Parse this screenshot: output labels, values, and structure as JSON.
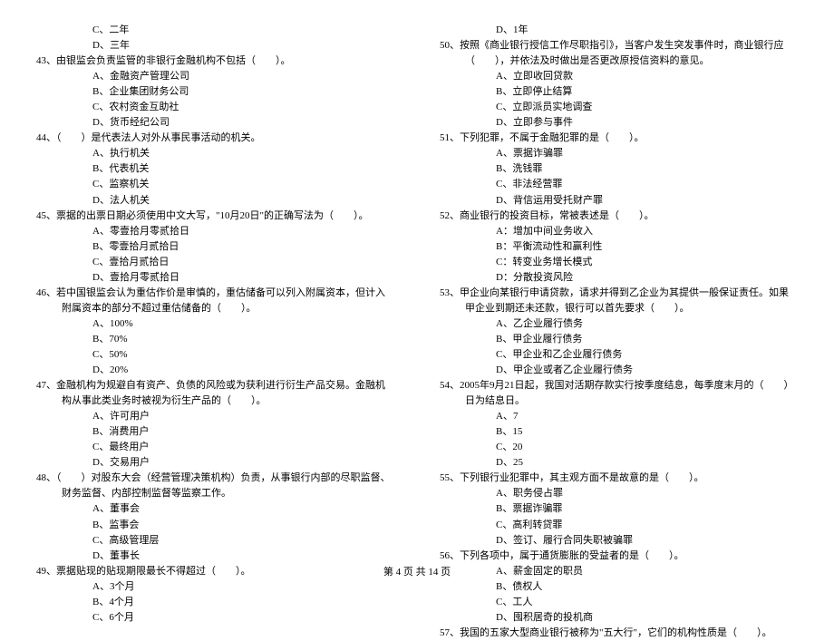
{
  "left": {
    "pre_options": [
      "C、二年",
      "D、三年"
    ],
    "questions": [
      {
        "num": "43",
        "text": "由银监会负责监管的非银行金融机构不包括（　　）。",
        "options": [
          "A、金融资产管理公司",
          "B、企业集团财务公司",
          "C、农村资金互助社",
          "D、货币经纪公司"
        ]
      },
      {
        "num": "44",
        "text": "（　　）是代表法人对外从事民事活动的机关。",
        "options": [
          "A、执行机关",
          "B、代表机关",
          "C、监察机关",
          "D、法人机关"
        ]
      },
      {
        "num": "45",
        "text": "票据的出票日期必须使用中文大写，\"10月20日\"的正确写法为（　　）。",
        "options": [
          "A、零壹拾月零贰拾日",
          "B、零壹拾月贰拾日",
          "C、壹拾月贰拾日",
          "D、壹拾月零贰拾日"
        ]
      },
      {
        "num": "46",
        "text": "若中国银监会认为重估作价是审慎的，重估储备可以列入附属资本，但计入附属资本的部分不超过重估储备的（　　）。",
        "options": [
          "A、100%",
          "B、70%",
          "C、50%",
          "D、20%"
        ]
      },
      {
        "num": "47",
        "text": "金融机构为规避自有资产、负债的风险或为获利进行衍生产品交易。金融机构从事此类业务时被视为衍生产品的（　　）。",
        "options": [
          "A、许可用户",
          "B、消费用户",
          "C、最终用户",
          "D、交易用户"
        ]
      },
      {
        "num": "48",
        "text": "（　　）对股东大会（经营管理决策机构）负责，从事银行内部的尽职监督、财务监督、内部控制监督等监察工作。",
        "options": [
          "A、董事会",
          "B、监事会",
          "C、高级管理层",
          "D、董事长"
        ]
      },
      {
        "num": "49",
        "text": "票据贴现的贴现期限最长不得超过（　　）。",
        "options": [
          "A、3个月",
          "B、4个月",
          "C、6个月"
        ]
      }
    ]
  },
  "right": {
    "pre_options": [
      "D、1年"
    ],
    "questions": [
      {
        "num": "50",
        "text": "按照《商业银行授信工作尽职指引》，当客户发生突发事件时，商业银行应（　　），并依法及时做出是否更改原授信资料的意见。",
        "options": [
          "A、立即收回贷款",
          "B、立即停止结算",
          "C、立即派员实地调查",
          "D、立即参与事件"
        ]
      },
      {
        "num": "51",
        "text": "下列犯罪，不属于金融犯罪的是（　　）。",
        "options": [
          "A、票据诈骗罪",
          "B、洗钱罪",
          "C、非法经营罪",
          "D、背信运用受托财产罪"
        ]
      },
      {
        "num": "52",
        "text": "商业银行的投资目标，常被表述是（　　）。",
        "options": [
          "A：增加中间业务收入",
          "B：平衡流动性和赢利性",
          "C：转变业务增长模式",
          "D：分散投资风险"
        ]
      },
      {
        "num": "53",
        "text": "甲企业向某银行申请贷款，请求并得到乙企业为其提供一般保证责任。如果甲企业到期还未还款，银行可以首先要求（　　）。",
        "options": [
          "A、乙企业履行债务",
          "B、甲企业履行债务",
          "C、甲企业和乙企业履行债务",
          "D、甲企业或者乙企业履行债务"
        ]
      },
      {
        "num": "54",
        "text": "2005年9月21日起，我国对活期存款实行按季度结息，每季度末月的（　　）日为结息日。",
        "options": [
          "A、7",
          "B、15",
          "C、20",
          "D、25"
        ]
      },
      {
        "num": "55",
        "text": "下列银行业犯罪中，其主观方面不是故意的是（　　）。",
        "options": [
          "A、职务侵占罪",
          "B、票据诈骗罪",
          "C、高利转贷罪",
          "D、签订、履行合同失职被骗罪"
        ]
      },
      {
        "num": "56",
        "text": "下列各项中，属于通货膨胀的受益者的是（　　）。",
        "options": [
          "A、薪金固定的职员",
          "B、债权人",
          "C、工人",
          "D、囤积居奇的投机商"
        ]
      },
      {
        "num": "57",
        "text": "我国的五家大型商业银行被称为\"五大行\"，它们的机构性质是（　　）。",
        "options": []
      }
    ]
  },
  "footer": "第 4 页 共 14 页"
}
